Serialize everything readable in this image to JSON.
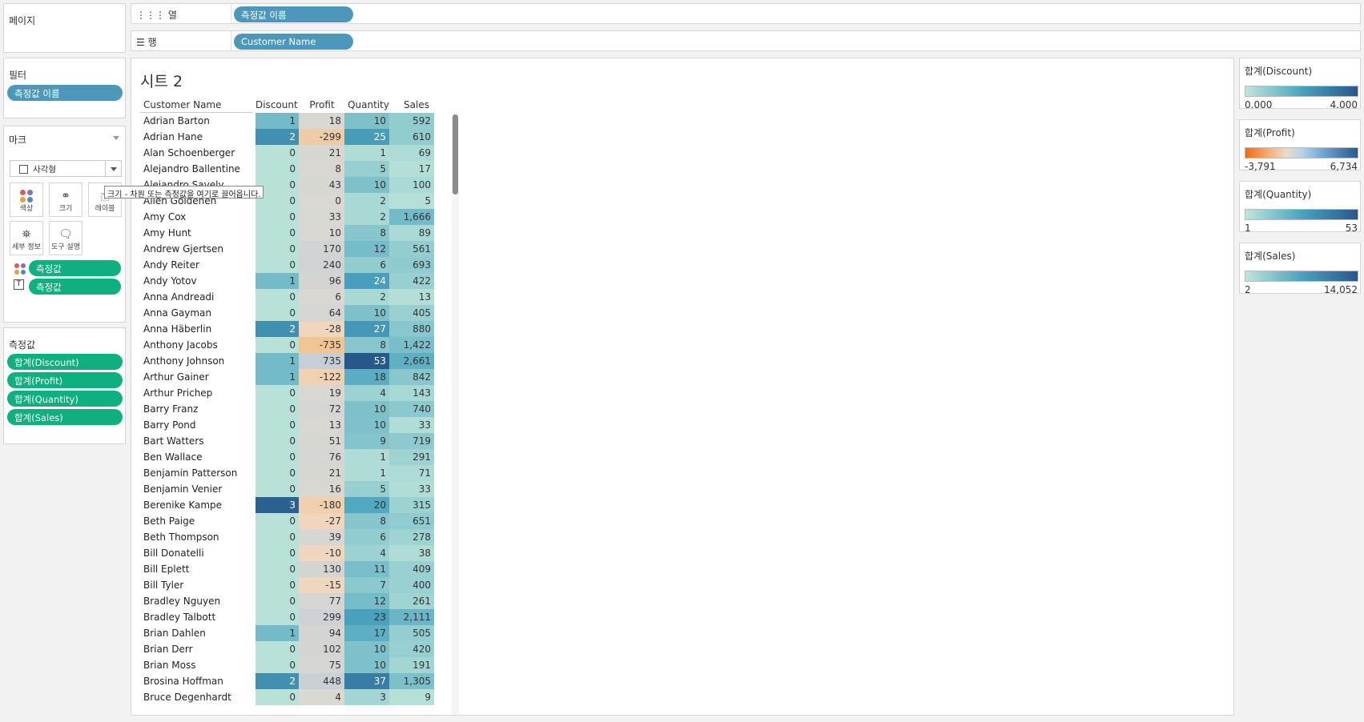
{
  "shelves": {
    "columns_label": "열",
    "columns_pill": "측정값 이름",
    "rows_label": "행",
    "rows_pill": "Customer Name"
  },
  "pages_panel": {
    "title": "페이지"
  },
  "filters_panel": {
    "title": "필터",
    "pill": "측정값 이름"
  },
  "marks_panel": {
    "title": "마크",
    "mark_type": "사각형",
    "buttons": {
      "color": "색상",
      "size": "크기",
      "label": "레이블",
      "detail": "세부 정보",
      "tooltip": "도구 설명"
    },
    "pills": [
      "측정값",
      "측정값"
    ]
  },
  "measure_values_panel": {
    "title": "측정값",
    "pills": [
      "합계(Discount)",
      "합계(Profit)",
      "합계(Quantity)",
      "합계(Sales)"
    ]
  },
  "tooltip_text": "크기 - 차원 또는 측정값을 여기로 끌어옵니다.",
  "sheet_title": "시트 2",
  "columns": [
    "Customer Name",
    "Discount",
    "Profit",
    "Quantity",
    "Sales"
  ],
  "rows": [
    [
      "Adrian Barton",
      "1",
      "18",
      "10",
      "592"
    ],
    [
      "Adrian Hane",
      "2",
      "-299",
      "25",
      "610"
    ],
    [
      "Alan Schoenberger",
      "0",
      "21",
      "1",
      "69"
    ],
    [
      "Alejandro Ballentine",
      "0",
      "8",
      "5",
      "17"
    ],
    [
      "Alejandro Savely",
      "0",
      "43",
      "10",
      "100"
    ],
    [
      "Allen Goldenen",
      "0",
      "0",
      "2",
      "5"
    ],
    [
      "Amy Cox",
      "0",
      "33",
      "2",
      "1,666"
    ],
    [
      "Amy Hunt",
      "0",
      "10",
      "8",
      "89"
    ],
    [
      "Andrew Gjertsen",
      "0",
      "170",
      "12",
      "561"
    ],
    [
      "Andy Reiter",
      "0",
      "240",
      "6",
      "693"
    ],
    [
      "Andy Yotov",
      "1",
      "96",
      "24",
      "422"
    ],
    [
      "Anna Andreadi",
      "0",
      "6",
      "2",
      "13"
    ],
    [
      "Anna Gayman",
      "0",
      "64",
      "10",
      "405"
    ],
    [
      "Anna Häberlin",
      "2",
      "-28",
      "27",
      "880"
    ],
    [
      "Anthony Jacobs",
      "0",
      "-735",
      "8",
      "1,422"
    ],
    [
      "Anthony Johnson",
      "1",
      "735",
      "53",
      "2,661"
    ],
    [
      "Arthur Gainer",
      "1",
      "-122",
      "18",
      "842"
    ],
    [
      "Arthur Prichep",
      "0",
      "19",
      "4",
      "143"
    ],
    [
      "Barry Franz",
      "0",
      "72",
      "10",
      "740"
    ],
    [
      "Barry Pond",
      "0",
      "13",
      "10",
      "33"
    ],
    [
      "Bart Watters",
      "0",
      "51",
      "9",
      "719"
    ],
    [
      "Ben Wallace",
      "0",
      "76",
      "1",
      "291"
    ],
    [
      "Benjamin Patterson",
      "0",
      "21",
      "1",
      "71"
    ],
    [
      "Benjamin Venier",
      "0",
      "16",
      "5",
      "33"
    ],
    [
      "Berenike Kampe",
      "3",
      "-180",
      "20",
      "315"
    ],
    [
      "Beth Paige",
      "0",
      "-27",
      "8",
      "651"
    ],
    [
      "Beth Thompson",
      "0",
      "39",
      "6",
      "278"
    ],
    [
      "Bill Donatelli",
      "0",
      "-10",
      "4",
      "38"
    ],
    [
      "Bill Eplett",
      "0",
      "130",
      "11",
      "409"
    ],
    [
      "Bill Tyler",
      "0",
      "-15",
      "7",
      "400"
    ],
    [
      "Bradley Nguyen",
      "0",
      "77",
      "12",
      "261"
    ],
    [
      "Bradley Talbott",
      "0",
      "299",
      "23",
      "2,111"
    ],
    [
      "Brian Dahlen",
      "1",
      "94",
      "17",
      "505"
    ],
    [
      "Brian Derr",
      "0",
      "102",
      "10",
      "420"
    ],
    [
      "Brian Moss",
      "0",
      "75",
      "10",
      "191"
    ],
    [
      "Brosina Hoffman",
      "2",
      "448",
      "37",
      "1,305"
    ],
    [
      "Bruce Degenhardt",
      "0",
      "4",
      "3",
      "9"
    ]
  ],
  "legends": [
    {
      "title": "합계(Discount)",
      "min": "0.000",
      "max": "4.000"
    },
    {
      "title": "합계(Profit)",
      "min": "-3,791",
      "max": "6,734"
    },
    {
      "title": "합계(Quantity)",
      "min": "1",
      "max": "53"
    },
    {
      "title": "합계(Sales)",
      "min": "2",
      "max": "14,052"
    }
  ],
  "colors": {
    "pill_blue": "#4d97ba",
    "pill_green": "#0fb07f",
    "teal_low": "#b5e1d8",
    "teal_high": "#27588a",
    "orange_low": "#f07a24",
    "orange_mid": "#f3dcc0",
    "blue_pos": "#2a5a8e"
  }
}
